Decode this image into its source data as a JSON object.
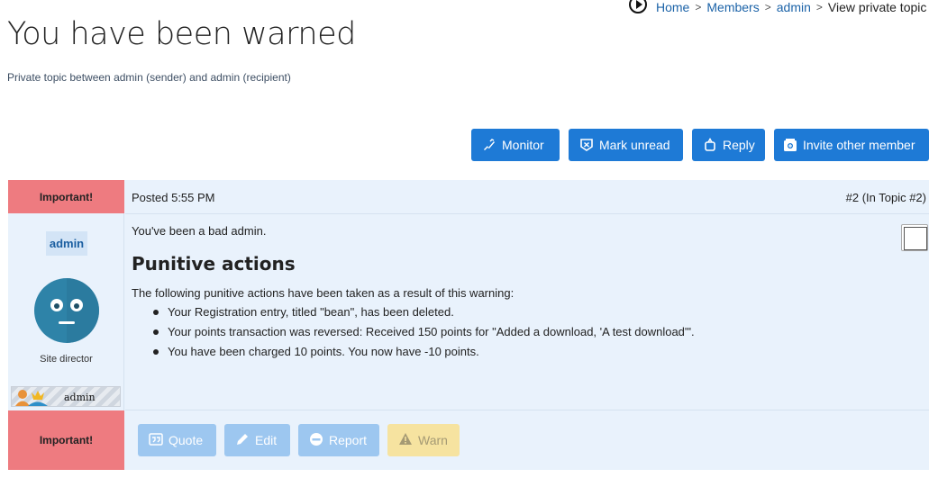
{
  "breadcrumb": {
    "items": [
      "Home",
      "Members",
      "admin"
    ],
    "current": "View private topic",
    "separator": ">"
  },
  "page": {
    "title": "You have been warned",
    "subtitle": "Private topic between admin (sender) and admin (recipient)"
  },
  "actions": {
    "monitor": "Monitor",
    "mark_unread": "Mark unread",
    "reply": "Reply",
    "invite": "Invite other member"
  },
  "post": {
    "important_top": "Important!",
    "important_bottom": "Important!",
    "posted": "Posted 5:55 PM",
    "number": "#2 (In Topic #2)",
    "author": {
      "username": "admin",
      "role": "Site director",
      "usercard": "admin"
    },
    "message": "You've been a bad admin.",
    "heading": "Punitive actions",
    "intro": "The following punitive actions have been taken as a result of this warning:",
    "items": [
      "Your Registration entry, titled \"bean\", has been deleted.",
      "Your points transaction was reversed: Received 150 points for \"Added a download, 'A test download'\".",
      "You have been charged 10 points. You now have -10 points."
    ],
    "buttons": {
      "quote": "Quote",
      "edit": "Edit",
      "report": "Report",
      "warn": "Warn"
    }
  },
  "colors": {
    "primary": "#1e7ad6",
    "important": "#ee7b80",
    "post_bg": "#e9f2fc",
    "disabled": "#9dc7f0",
    "warn_disabled": "#f6e3a0"
  },
  "icons": {
    "breadcrumb": "play-circle-icon",
    "monitor": "monitor-icon",
    "mark_unread": "mark-unread-icon",
    "reply": "reply-icon",
    "invite": "invite-icon",
    "quote": "quote-icon",
    "edit": "pencil-icon",
    "report": "report-icon",
    "warn": "warning-icon"
  }
}
